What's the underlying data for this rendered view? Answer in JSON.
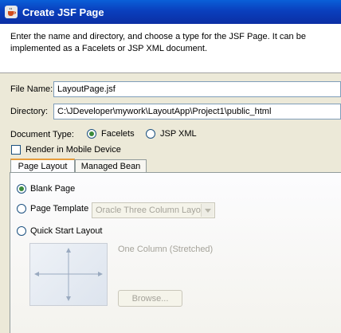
{
  "window": {
    "title": "Create JSF Page",
    "icon": "coffee-cup-icon"
  },
  "header": {
    "description": "Enter the name and directory, and choose a type for the JSF Page. It can be implemented as a Facelets or JSP XML document."
  },
  "form": {
    "file_name_label": "File Name:",
    "file_name_value": "LayoutPage.jsf",
    "directory_label": "Directory:",
    "directory_value": "C:\\JDeveloper\\mywork\\LayoutApp\\Project1\\public_html",
    "document_type_label": "Document Type:",
    "document_types": [
      {
        "label": "Facelets",
        "selected": true
      },
      {
        "label": "JSP XML",
        "selected": false
      }
    ],
    "render_mobile_label": "Render in Mobile Device",
    "render_mobile_checked": false
  },
  "tabs": [
    {
      "label": "Page Layout",
      "active": true
    },
    {
      "label": "Managed Bean",
      "active": false
    }
  ],
  "page_layout": {
    "blank_page_label": "Blank Page",
    "page_template_label": "Page Template",
    "page_template_value": "Oracle Three Column Layout",
    "quick_start_label": "Quick Start Layout",
    "quick_start_value": "One Column (Stretched)",
    "browse_label": "Browse..."
  }
}
